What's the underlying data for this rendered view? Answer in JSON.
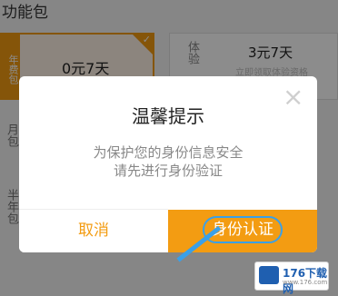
{
  "background": {
    "header_title": "功能包",
    "package_selected": {
      "tag": "年费包",
      "price": "0元7天"
    },
    "package_other": {
      "tag": "体验",
      "price": "3元7天",
      "note": "立即领取体验资格"
    },
    "side_labels": [
      "月包",
      "半年包"
    ]
  },
  "dialog": {
    "title": "温馨提示",
    "message_line1": "为保护您的身份信息安全",
    "message_line2": "请先进行身份验证",
    "cancel_label": "取消",
    "confirm_label": "身份认证"
  },
  "watermark": {
    "text": "176下载网",
    "sub": "www.176.com"
  },
  "colors": {
    "accent": "#f39c12",
    "annotation": "#3aa0e8"
  }
}
